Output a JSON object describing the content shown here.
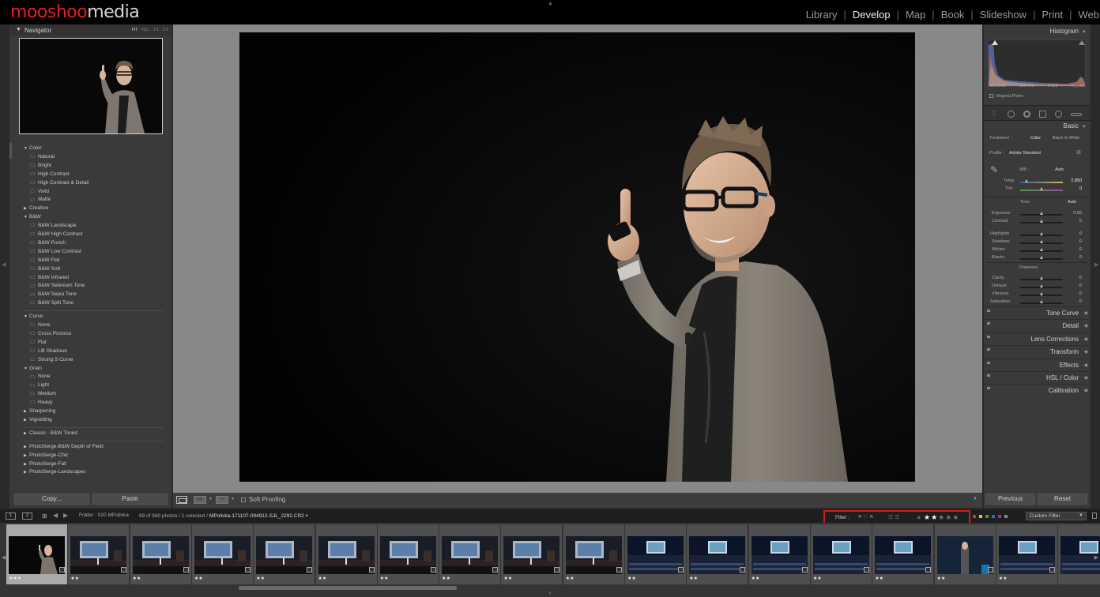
{
  "brand": {
    "part1": "mooshoo",
    "part2": "media"
  },
  "modules": [
    {
      "label": "Library",
      "active": false
    },
    {
      "label": "Develop",
      "active": true
    },
    {
      "label": "Map",
      "active": false
    },
    {
      "label": "Book",
      "active": false
    },
    {
      "label": "Slideshow",
      "active": false
    },
    {
      "label": "Print",
      "active": false
    },
    {
      "label": "Web",
      "active": false
    }
  ],
  "navigator": {
    "title": "Navigator",
    "zoom": [
      "FIT",
      "FILL",
      "1:1",
      "2:1"
    ]
  },
  "presets": {
    "groups": [
      {
        "label": "Color",
        "open": true,
        "items": [
          "Natural",
          "Bright",
          "High Contrast",
          "High Contrast & Detail",
          "Vivid",
          "Matte"
        ]
      },
      {
        "label": "Creative",
        "open": false,
        "items": []
      },
      {
        "label": "B&W",
        "open": true,
        "items": [
          "B&W Landscape",
          "B&W High Contrast",
          "B&W Punch",
          "B&W Low Contrast",
          "B&W Flat",
          "B&W Soft",
          "B&W Infrared",
          "B&W Selenium Tone",
          "B&W Sepia Tone",
          "B&W Split Tone"
        ]
      },
      {
        "label": "Curve",
        "open": true,
        "items": [
          "None",
          "Cross Process",
          "Flat",
          "Lift Shadows",
          "Strong S Curve"
        ]
      },
      {
        "label": "Grain",
        "open": true,
        "items": [
          "None",
          "Light",
          "Medium",
          "Heavy"
        ]
      },
      {
        "label": "Sharpening",
        "open": false,
        "items": []
      },
      {
        "label": "Vignetting",
        "open": false,
        "items": []
      },
      {
        "label": "Classic - B&W Toned",
        "open": false,
        "items": []
      },
      {
        "label": "PhotoSerge-B&W Depth of Field",
        "open": false,
        "items": []
      },
      {
        "label": "PhotoSerge-Chic",
        "open": false,
        "items": []
      },
      {
        "label": "PhotoSerge-Fall",
        "open": false,
        "items": []
      },
      {
        "label": "PhotoSerge-Landscapes",
        "open": false,
        "items": []
      }
    ]
  },
  "left_buttons": {
    "copy": "Copy...",
    "paste": "Paste"
  },
  "toolbar": {
    "soft_proofing": "Soft Proofing"
  },
  "histogram": {
    "title": "Histogram",
    "iso": "ISO 6400",
    "focal": "160 mm",
    "aperture": "f / 3.2",
    "shutter": "¹⁄₁₆₀ sec",
    "original_photo": "Original Photo"
  },
  "basic": {
    "title": "Basic",
    "treatment_label": "Treatment :",
    "treatment_color": "Color",
    "treatment_bw": "Black & White",
    "profile_label": "Profile :",
    "profile_value": "Adobe Standard",
    "wb_label": "WB :",
    "wb_value": "Auto",
    "temp_label": "Temp",
    "temp_value": "2,850",
    "temp_pos": 0.12,
    "tint_label": "Tint",
    "tint_value": "0",
    "tone_label": "Tone",
    "tone_auto": "Auto",
    "exposure": {
      "label": "Exposure",
      "value": "0.00"
    },
    "contrast": {
      "label": "Contrast",
      "value": "0"
    },
    "highlights": {
      "label": "Highlights",
      "value": "0"
    },
    "shadows": {
      "label": "Shadows",
      "value": "0"
    },
    "whites": {
      "label": "Whites",
      "value": "0"
    },
    "blacks": {
      "label": "Blacks",
      "value": "0"
    },
    "presence_label": "Presence",
    "clarity": {
      "label": "Clarity",
      "value": "0"
    },
    "dehaze": {
      "label": "Dehaze",
      "value": "0"
    },
    "vibrance": {
      "label": "Vibrance",
      "value": "0"
    },
    "saturation": {
      "label": "Saturation",
      "value": "0"
    }
  },
  "collapsed_panels": [
    "Tone Curve",
    "Detail",
    "Lens Corrections",
    "Transform",
    "Effects",
    "HSL / Color",
    "Calibration"
  ],
  "right_buttons": {
    "previous": "Previous",
    "reset": "Reset"
  },
  "filmstrip_bar": {
    "screen1": "1",
    "screen2": "2",
    "folder": "Folder : 020 MPolivka",
    "count": "89 of 940 photos / 1 selected / ",
    "filename": "MPolivka-171107-094912-SJL_2292.CR2",
    "filter_label": "Filter :",
    "filter_ge": "≥",
    "filter_rating": 2,
    "filter_rating_max": 5,
    "custom_filter": "Custom Filter"
  },
  "label_colors": [
    "#c33",
    "#cc3",
    "#3a3",
    "#36c",
    "#939",
    "#888"
  ],
  "filmstrip": {
    "thumbs": [
      {
        "kind": "portrait",
        "stars": "★★★",
        "selected": true
      },
      {
        "kind": "stage",
        "stars": "★★",
        "selected": false
      },
      {
        "kind": "stage",
        "stars": "★★",
        "selected": false
      },
      {
        "kind": "stage",
        "stars": "★★",
        "selected": false
      },
      {
        "kind": "stage",
        "stars": "★★",
        "selected": false
      },
      {
        "kind": "stage",
        "stars": "★★",
        "selected": false
      },
      {
        "kind": "stage",
        "stars": "★★",
        "selected": false
      },
      {
        "kind": "stage",
        "stars": "★★",
        "selected": false
      },
      {
        "kind": "stage",
        "stars": "★★",
        "selected": false
      },
      {
        "kind": "stage",
        "stars": "★★",
        "selected": false
      },
      {
        "kind": "hall",
        "stars": "★★",
        "selected": false
      },
      {
        "kind": "hall",
        "stars": "★★",
        "selected": false
      },
      {
        "kind": "hall",
        "stars": "★★",
        "selected": false
      },
      {
        "kind": "hall",
        "stars": "★★",
        "selected": false
      },
      {
        "kind": "hall",
        "stars": "★★",
        "selected": false
      },
      {
        "kind": "speaker",
        "stars": "★★",
        "selected": false
      },
      {
        "kind": "hall",
        "stars": "★★",
        "selected": false
      },
      {
        "kind": "hall",
        "stars": "",
        "selected": false
      }
    ]
  }
}
